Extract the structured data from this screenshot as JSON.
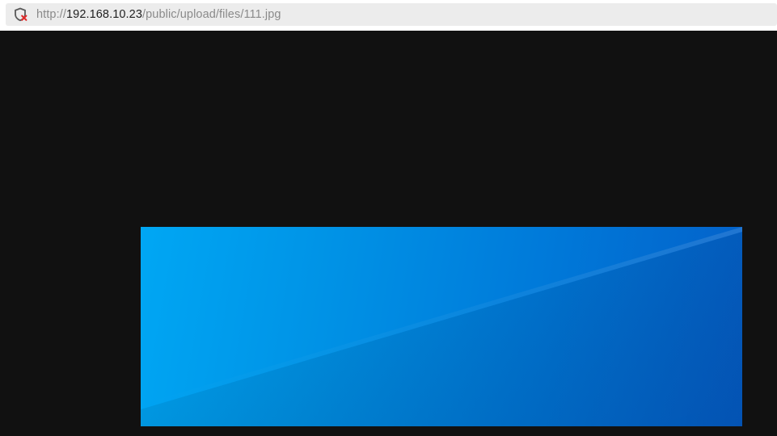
{
  "address_bar": {
    "url_scheme": "http://",
    "url_host": "192.168.10.23",
    "url_path": "/public/upload/files/111.jpg",
    "security_icon": "insecure-shield-icon"
  },
  "viewer": {
    "background_color": "#111111",
    "image_colors": [
      "#00a7f4",
      "#0079d9",
      "#045fc8"
    ]
  }
}
